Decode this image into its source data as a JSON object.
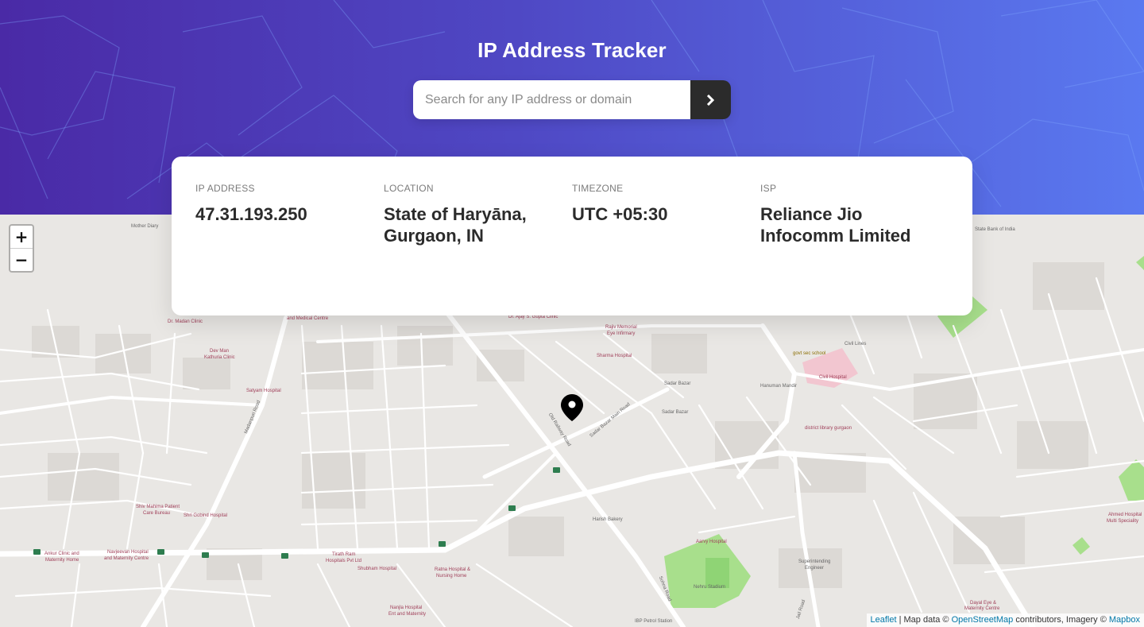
{
  "header": {
    "title": "IP Address Tracker",
    "search_placeholder": "Search for any IP address or domain",
    "search_value": "",
    "submit_icon": "chevron-right-icon"
  },
  "info": {
    "ip_label": "IP ADDRESS",
    "ip_value": "47.31.193.250",
    "location_label": "LOCATION",
    "location_value": "State of Haryāna, Gurgaon, IN",
    "timezone_label": "TIMEZONE",
    "timezone_value": "UTC +05:30",
    "isp_label": "ISP",
    "isp_value": "Reliance Jio Infocomm Limited"
  },
  "map": {
    "zoom_in": "+",
    "zoom_out": "−",
    "marker_icon": "location-pin-icon",
    "attribution": {
      "leaflet": "Leaflet",
      "sep": " | Map data © ",
      "osm": "OpenStreetMap",
      "mid": " contributors, Imagery © ",
      "mapbox": "Mapbox"
    },
    "labels": {
      "mother_dairy": "Mother Diary",
      "state_bank": "State Bank of India",
      "dr_madan": "Dr. Madan Clinic",
      "medical_centre": "and Medical Centre",
      "ajay": "Dr. Ajay S. Gupta Clinic",
      "rajiv": "Rajiv Memorial",
      "eye": "Eye Infirmary",
      "sharma": "Sharma Hospital",
      "dev_man": "Dev Man",
      "kathuria": "Kathuria Clinic",
      "satyam": "Satyam Hospital",
      "madanpuri": "Madanpuri Road",
      "old_railway": "Old Railway Road",
      "sadar_bazar_main": "Sadar Bazar Main Road",
      "sadar_bazar_1": "Sadar Bazar",
      "sadar_bazar_2": "Sadar Bazar",
      "hanuman": "Hanuman Mandir",
      "govt_school": "govt sec school",
      "civil_lines": "Civil Lines",
      "civil_hospital": "Civil Hospital",
      "district_library": "district library gurgaon",
      "shiv_mahima": "Shiv Mahima Patient",
      "care_bureau": "Care Bureau",
      "shri_gobind": "Shri Gobind Hospital",
      "ankur": "Ankur Clinic and",
      "maternity": "Maternity Home",
      "navjeevan": "Navjeevan Hospital",
      "navjeevan2": "and Maternity Centre",
      "tirath": "Tirath Ram",
      "tirath2": "Hospitals Pvt Ltd",
      "shubham": "Shubham Hospital",
      "ratna": "Ratna Hospital &",
      "ratna2": "Nursing Home",
      "harish": "Harish Bakery",
      "aarvy": "Aarvy Hospital",
      "nehru": "Nehru Stadium",
      "sohna": "Sohna Road",
      "superintending": "Superintending",
      "engineer": "Engineer",
      "nanjla": "Nanjla Hospital",
      "nanjla2": "Ent and Maternity",
      "ibp": "IBP Petrol Station",
      "dayal": "Dayal Eye &",
      "dayal2": "Maternity Centre",
      "ahmed": "Ahmed Hospital",
      "ahmed2": "Multi Speciality",
      "jail_road": "Jail Road"
    }
  },
  "colors": {
    "gradient_start": "#4a2aa6",
    "gradient_end": "#5a79f0",
    "text_dark": "#2b2b2b",
    "label_grey": "#7b7b7b"
  }
}
